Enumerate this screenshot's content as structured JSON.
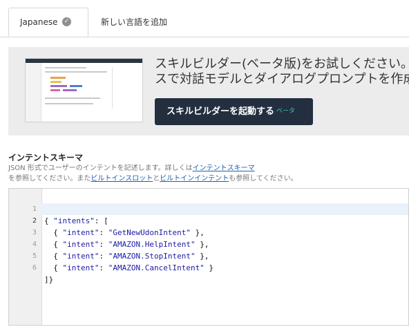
{
  "tabs": {
    "active_label": "Japanese",
    "add_label": "新しい言語を追加"
  },
  "banner": {
    "line1": "スキルビルダー(ベータ版)をお試しください。",
    "line2": "スで対話モデルとダイアログプロンプトを作成",
    "button_label": "スキルビルダーを起動する",
    "button_badge": "ベータ"
  },
  "schema": {
    "title": "インテントスキーマ",
    "desc_pre": "JSON 形式でユーザーのインテントを記述します。詳しくは",
    "link_schema": "インテントスキーマ",
    "desc_mid1": "を参照してください。また",
    "link_slot": "ビルトインスロット",
    "desc_mid2": "と",
    "link_intent": "ビルトインインテント",
    "desc_post": "も参照してください。"
  },
  "editor": {
    "lines": [
      {
        "num": "1",
        "text": "{ \"intents\": ["
      },
      {
        "num": "2",
        "text": "  { \"intent\": \"GetNewUdonIntent\" },"
      },
      {
        "num": "3",
        "text": "  { \"intent\": \"AMAZON.HelpIntent\" },"
      },
      {
        "num": "4",
        "text": "  { \"intent\": \"AMAZON.StopIntent\" },"
      },
      {
        "num": "5",
        "text": "  { \"intent\": \"AMAZON.CancelIntent\" }"
      },
      {
        "num": "6",
        "text": "]}"
      }
    ]
  },
  "colors": {
    "button_bg": "#232f3e",
    "beta_badge": "#36c2b4",
    "link": "#1a5fb4",
    "active_line": "#e9f1fb"
  }
}
